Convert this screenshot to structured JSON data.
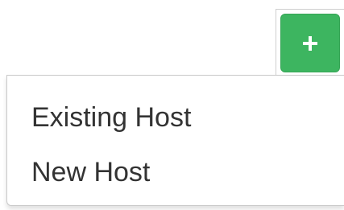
{
  "add_button": {
    "icon": "plus-icon",
    "color": "#3db560"
  },
  "dropdown": {
    "items": [
      {
        "label": "Existing Host"
      },
      {
        "label": "New Host"
      }
    ]
  }
}
